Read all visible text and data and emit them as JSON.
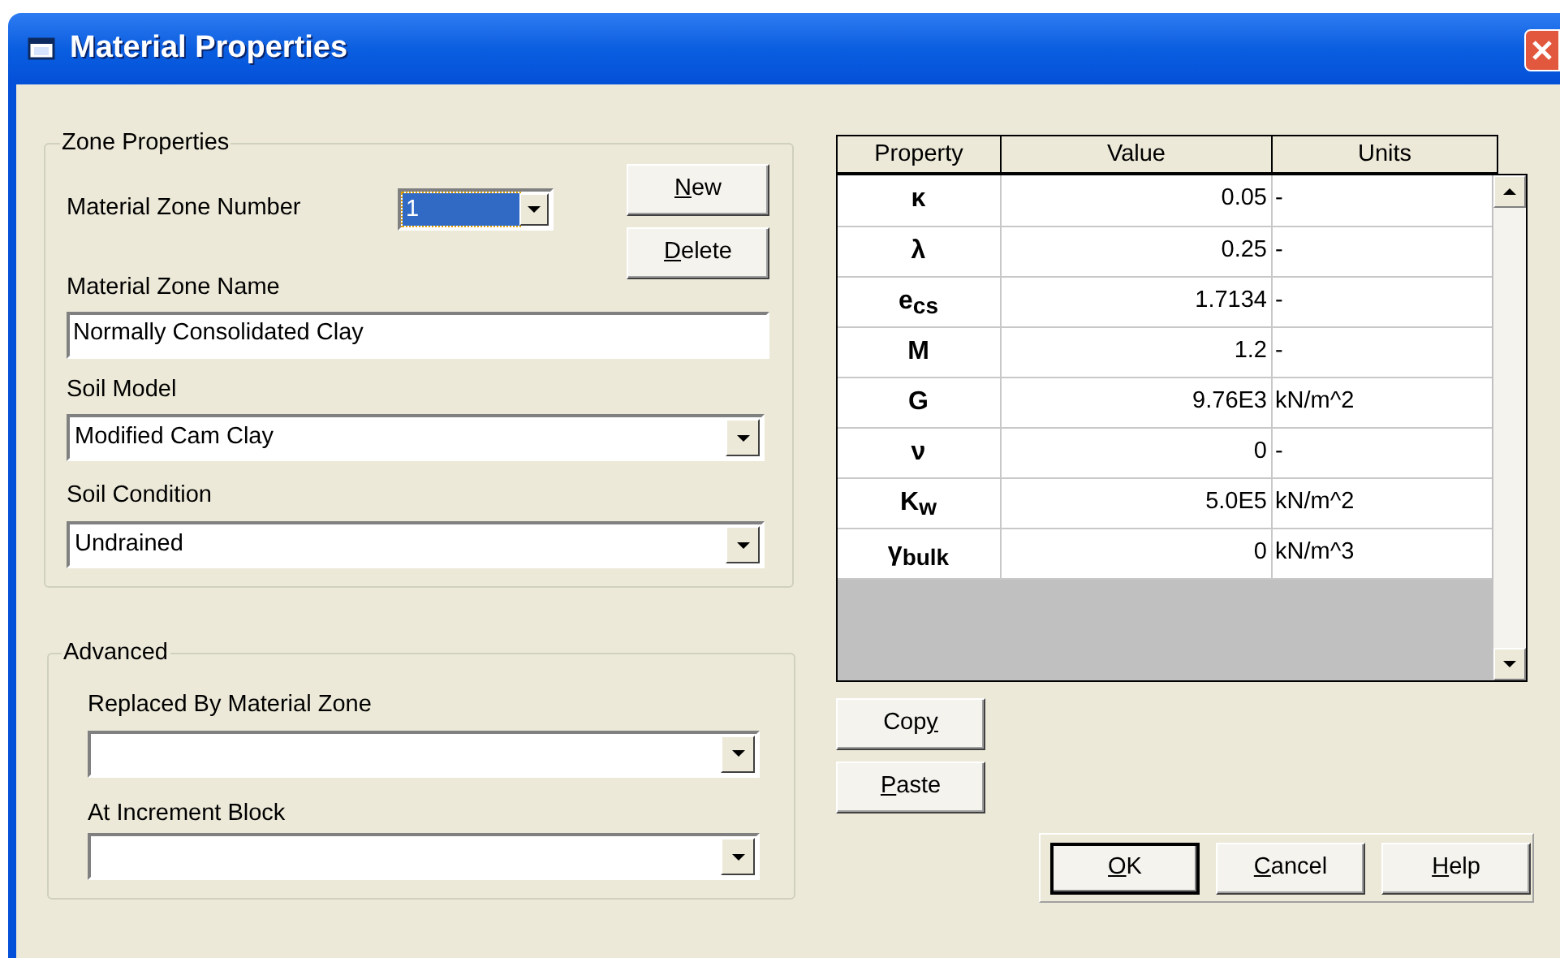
{
  "window": {
    "title": "Material Properties"
  },
  "zone_properties": {
    "title": "Zone Properties",
    "material_zone_number": {
      "label": "Material Zone Number",
      "value": "1",
      "highlighted": true
    },
    "buttons": [
      {
        "mnemonic": "N",
        "rest": "ew"
      },
      {
        "mnemonic": "D",
        "rest": "elete"
      }
    ],
    "material_zone_name": {
      "label": "Material Zone Name",
      "value": "Normally Consolidated Clay"
    },
    "soil_model": {
      "label": "Soil Model",
      "value": "Modified Cam Clay"
    },
    "soil_condition": {
      "label": "Soil Condition",
      "value": "Undrained"
    }
  },
  "advanced": {
    "title": "Advanced",
    "replaced_by_material_zone": {
      "label": "Replaced By Material Zone"
    },
    "at_increment_block": {
      "label": "At Increment Block"
    }
  },
  "table": {
    "columns": [
      "Property",
      "Value",
      "Units"
    ],
    "rows": [
      {
        "property": "κ",
        "value": "0.05",
        "units": "-"
      },
      {
        "property": "λ",
        "value": "0.25",
        "units": "-"
      },
      {
        "property": "e$_{cs}$",
        "value": "1.7134",
        "units": "-"
      },
      {
        "property": "M",
        "value": "1.2",
        "units": "-"
      },
      {
        "property": "G",
        "value": "9.76E3",
        "units": "kN/m^2"
      },
      {
        "property": "ν",
        "value": "0",
        "units": "-"
      },
      {
        "property": "K$_{w}$",
        "value": "5.0E5",
        "units": "kN/m^2"
      },
      {
        "property": "γ$_{bulk}$",
        "value": "0",
        "units": "kN/m^3"
      }
    ]
  },
  "clipboard_buttons": [
    {
      "prefix": "Cop",
      "mnemonic": "y"
    },
    {
      "mnemonic": "P",
      "rest": "aste"
    }
  ],
  "dialog_buttons": [
    {
      "mnemonic": "O",
      "rest": "K",
      "default": true
    },
    {
      "mnemonic": "C",
      "rest": "ancel",
      "default": false
    },
    {
      "mnemonic": "H",
      "rest": "elp",
      "default": false
    }
  ]
}
